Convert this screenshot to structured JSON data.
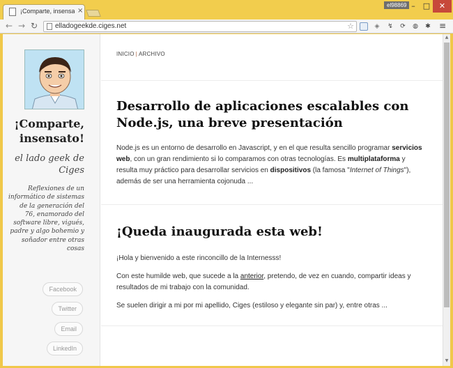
{
  "browser": {
    "tab_title": "¡Comparte, insensato! (el l",
    "tab_close": "×",
    "user_badge": "el98869",
    "window_controls": {
      "minimize": "–",
      "maximize": "□",
      "close": "✕"
    },
    "nav": {
      "back": "←",
      "forward": "→",
      "reload": "↻"
    },
    "url": "elladogeekde.ciges.net",
    "star": "☆",
    "menu": "≡"
  },
  "sidebar": {
    "site_title": "¡Comparte, insensato!",
    "tagline": "el lado geek de Ciges",
    "bio": "Reflexiones de un informático de sistemas de la generación del 76, enamorado del software libre, vigués, padre y algo bohemio y soñador entre otras cosas",
    "social": [
      "Facebook",
      "Twitter",
      "Email",
      "LinkedIn"
    ]
  },
  "breadcrumb": {
    "home": "INICIO",
    "separator": "|",
    "archive": "ARCHIVO"
  },
  "posts": [
    {
      "title": "Desarrollo de aplicaciones escalables con Node.js, una breve presentación",
      "paragraphs": [
        {
          "t1": "Node.js es un entorno de desarrollo en Javascript, y en el que resulta sencillo programar ",
          "b1": "servicios web",
          "t2": ", con un gran rendimiento si lo comparamos con otras tecnologías. Es ",
          "b2": "multiplataforma",
          "t3": " y resulta muy práctico para desarrollar servicios en ",
          "b3": "dispositivos",
          "t4": " (la famosa \"",
          "i1": "Internet of Things",
          "t5": "\"), además de ser una herramienta cojonuda ..."
        }
      ]
    },
    {
      "title": "¡Queda inaugurada esta web!",
      "p1": "¡Hola y bienvenido a este rinconcillo de la Internesss!",
      "p2_a": "Con este humilde web, que sucede a la ",
      "p2_link": "anterior",
      "p2_b": ", pretendo, de vez en cuando, compartir ideas y resultados de mi trabajo con la comunidad.",
      "p3": "Se suelen dirigir a mi por mi apellido, Ciges (estiloso y elegante sin par) y, entre otras ..."
    }
  ],
  "colors": {
    "chrome": "#f2cd4d",
    "accent": "#b06a4a",
    "sidebar_bg": "#f6f6f6"
  }
}
